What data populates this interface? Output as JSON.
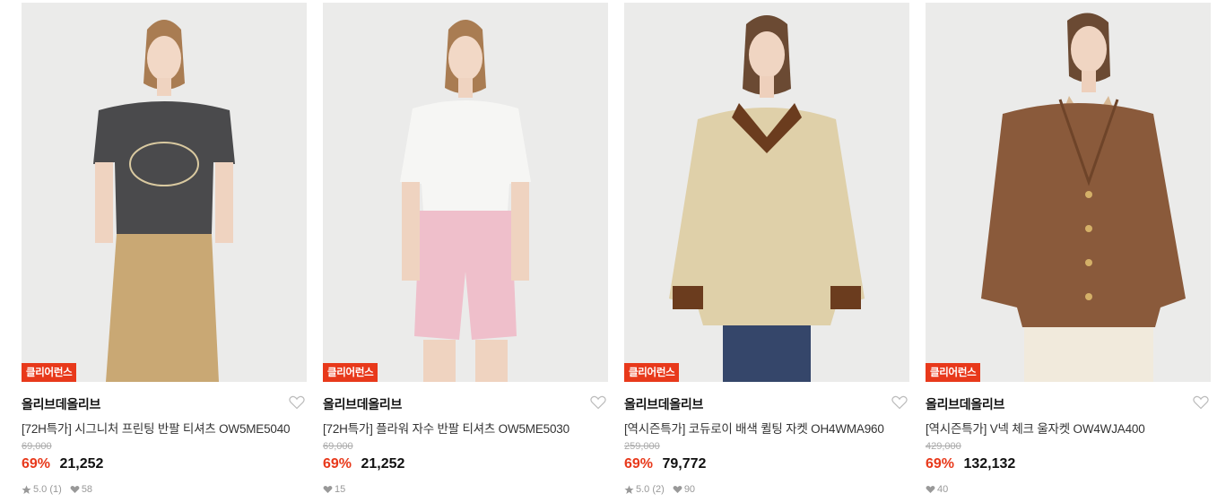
{
  "products": [
    {
      "badge": "클리어런스",
      "brand": "올리브데올리브",
      "title": "[72H특가] 시그니처 프린팅 반팔 티셔츠 OW5ME5040",
      "original_price": "69,000",
      "discount": "69%",
      "sale_price": "21,252",
      "rating": "5.0",
      "review_count": "(1)",
      "likes": "58",
      "top_color": "#4a4a4c",
      "bottom_color": "#c9a874"
    },
    {
      "badge": "클리어런스",
      "brand": "올리브데올리브",
      "title": "[72H특가] 플라워 자수 반팔 티셔츠 OW5ME5030",
      "original_price": "69,000",
      "discount": "69%",
      "sale_price": "21,252",
      "rating": "",
      "review_count": "",
      "likes": "15",
      "top_color": "#f6f6f4",
      "bottom_color": "#efbfcb"
    },
    {
      "badge": "클리어런스",
      "brand": "올리브데올리브",
      "title": "[역시즌특가] 코듀로이 배색 퀼팅 자켓 OH4WMA960",
      "original_price": "259,000",
      "discount": "69%",
      "sale_price": "79,772",
      "rating": "5.0",
      "review_count": "(2)",
      "likes": "90",
      "top_color": "#dfd0a9",
      "bottom_color": "#35466a"
    },
    {
      "badge": "클리어런스",
      "brand": "올리브데올리브",
      "title": "[역시즌특가] V넥 체크 울자켓 OW4WJA400",
      "original_price": "429,000",
      "discount": "69%",
      "sale_price": "132,132",
      "rating": "",
      "review_count": "",
      "likes": "40",
      "top_color": "#8a5a3b",
      "bottom_color": "#f1eadc"
    }
  ]
}
